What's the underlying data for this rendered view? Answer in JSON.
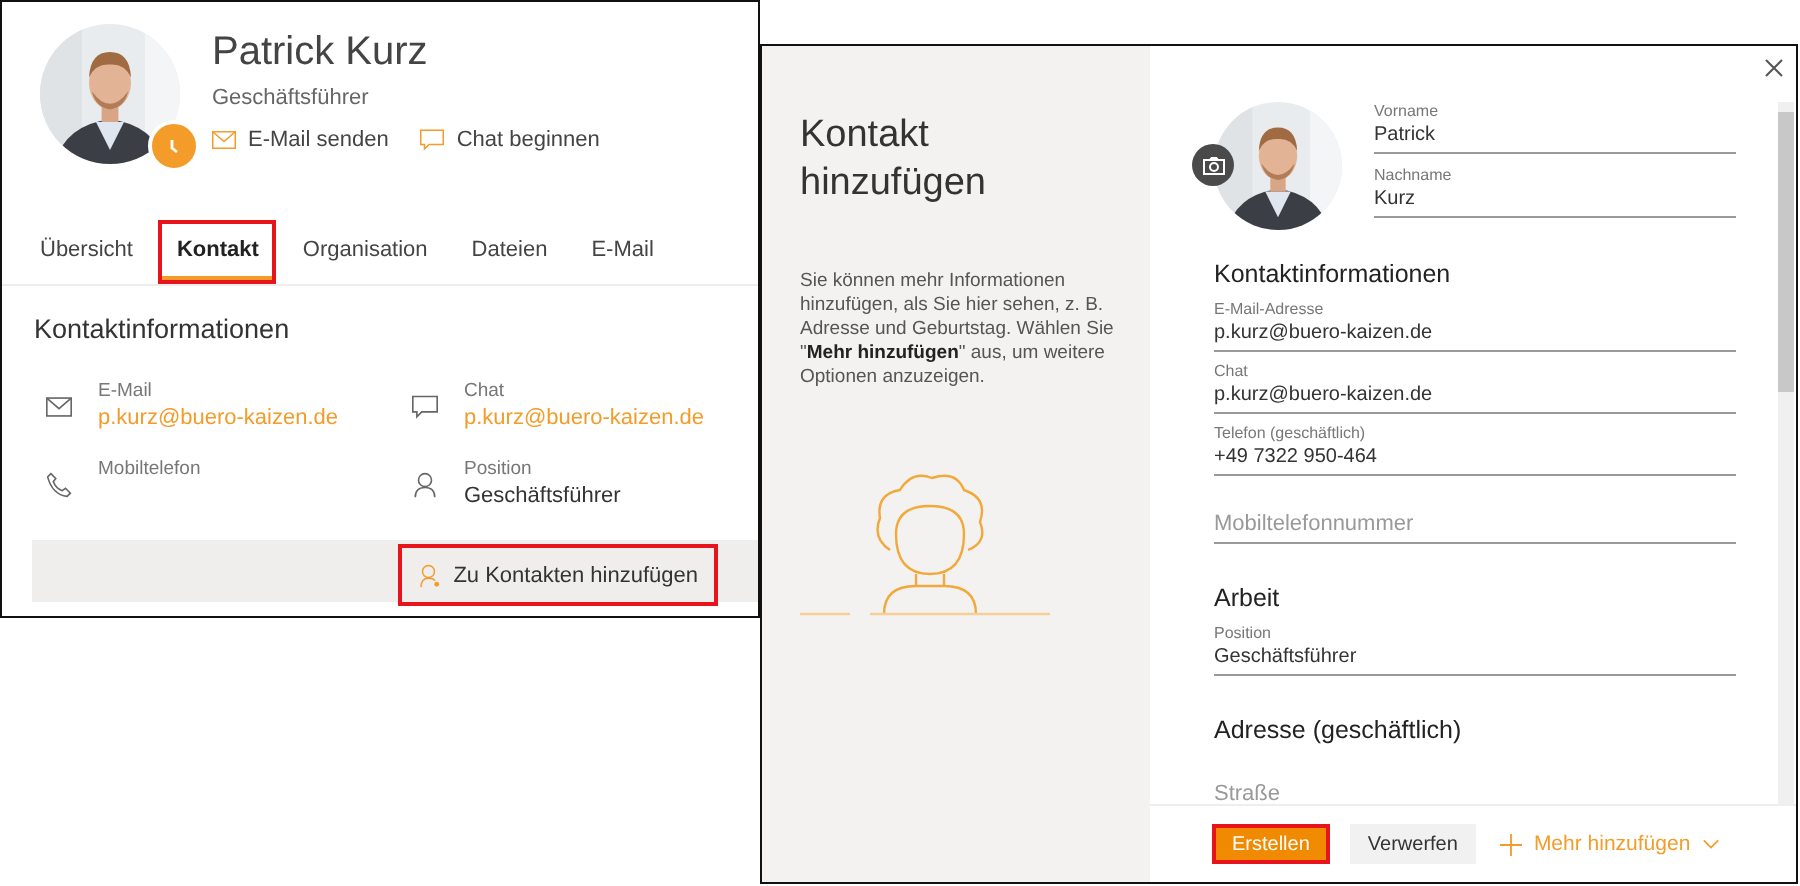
{
  "profile_card": {
    "name": "Patrick Kurz",
    "role": "Geschäftsführer",
    "away": true,
    "actions": [
      {
        "kind": "mail",
        "label": "E-Mail senden"
      },
      {
        "kind": "chat",
        "label": "Chat beginnen"
      }
    ],
    "tabs": [
      {
        "label": "Übersicht",
        "selected": false,
        "highlighted": false
      },
      {
        "label": "Kontakt",
        "selected": true,
        "highlighted": true
      },
      {
        "label": "Organisation",
        "selected": false,
        "highlighted": false
      },
      {
        "label": "Dateien",
        "selected": false,
        "highlighted": false
      },
      {
        "label": "E-Mail",
        "selected": false,
        "highlighted": false
      }
    ],
    "section_title": "Kontaktinformationen",
    "fields": [
      {
        "kind": "mail",
        "label": "E-Mail",
        "value": "p.kurz@buero-kaizen.de",
        "link": true
      },
      {
        "kind": "chat",
        "label": "Chat",
        "value": "p.kurz@buero-kaizen.de",
        "link": true
      },
      {
        "kind": "phone",
        "label": "Mobiltelefon"
      },
      {
        "kind": "person",
        "label": "Position",
        "value": "Geschäftsführer",
        "link": false
      }
    ],
    "add_button": {
      "label": "Zu Kontakten hinzufügen",
      "highlighted": true
    }
  },
  "dialog": {
    "title": "Kontakt hinzufügen",
    "hint": "Sie können mehr Informationen hinzufügen, als Sie hier sehen, z. B. Adresse und Geburtstag. Wählen Sie \"**Mehr hinzufügen**\" aus, um weitere Optionen anzuzeigen.",
    "name_fields": [
      {
        "label": "Vorname",
        "value": "Patrick"
      },
      {
        "label": "Nachname",
        "value": "Kurz"
      }
    ],
    "sections": [
      {
        "kind": "heading",
        "text": "Kontaktinformationen"
      },
      {
        "kind": "field",
        "label": "E-Mail-Adresse",
        "value": "p.kurz@buero-kaizen.de"
      },
      {
        "kind": "field",
        "label": "Chat",
        "value": "p.kurz@buero-kaizen.de"
      },
      {
        "kind": "field",
        "label": "Telefon (geschäftlich)",
        "value": "+49 7322 950-464"
      },
      {
        "kind": "empty",
        "placeholder": "Mobiltelefonnummer"
      },
      {
        "kind": "heading",
        "text": "Arbeit"
      },
      {
        "kind": "field",
        "label": "Position",
        "value": "Geschäftsführer"
      },
      {
        "kind": "heading",
        "text": "Adresse (geschäftlich)"
      },
      {
        "kind": "empty",
        "placeholder": "Straße"
      }
    ],
    "buttons": [
      {
        "kind": "primary",
        "label": "Erstellen",
        "highlighted": true
      },
      {
        "kind": "secondary",
        "label": "Verwerfen",
        "highlighted": false
      },
      {
        "kind": "more",
        "label": "Mehr hinzufügen",
        "highlighted": false
      }
    ]
  }
}
